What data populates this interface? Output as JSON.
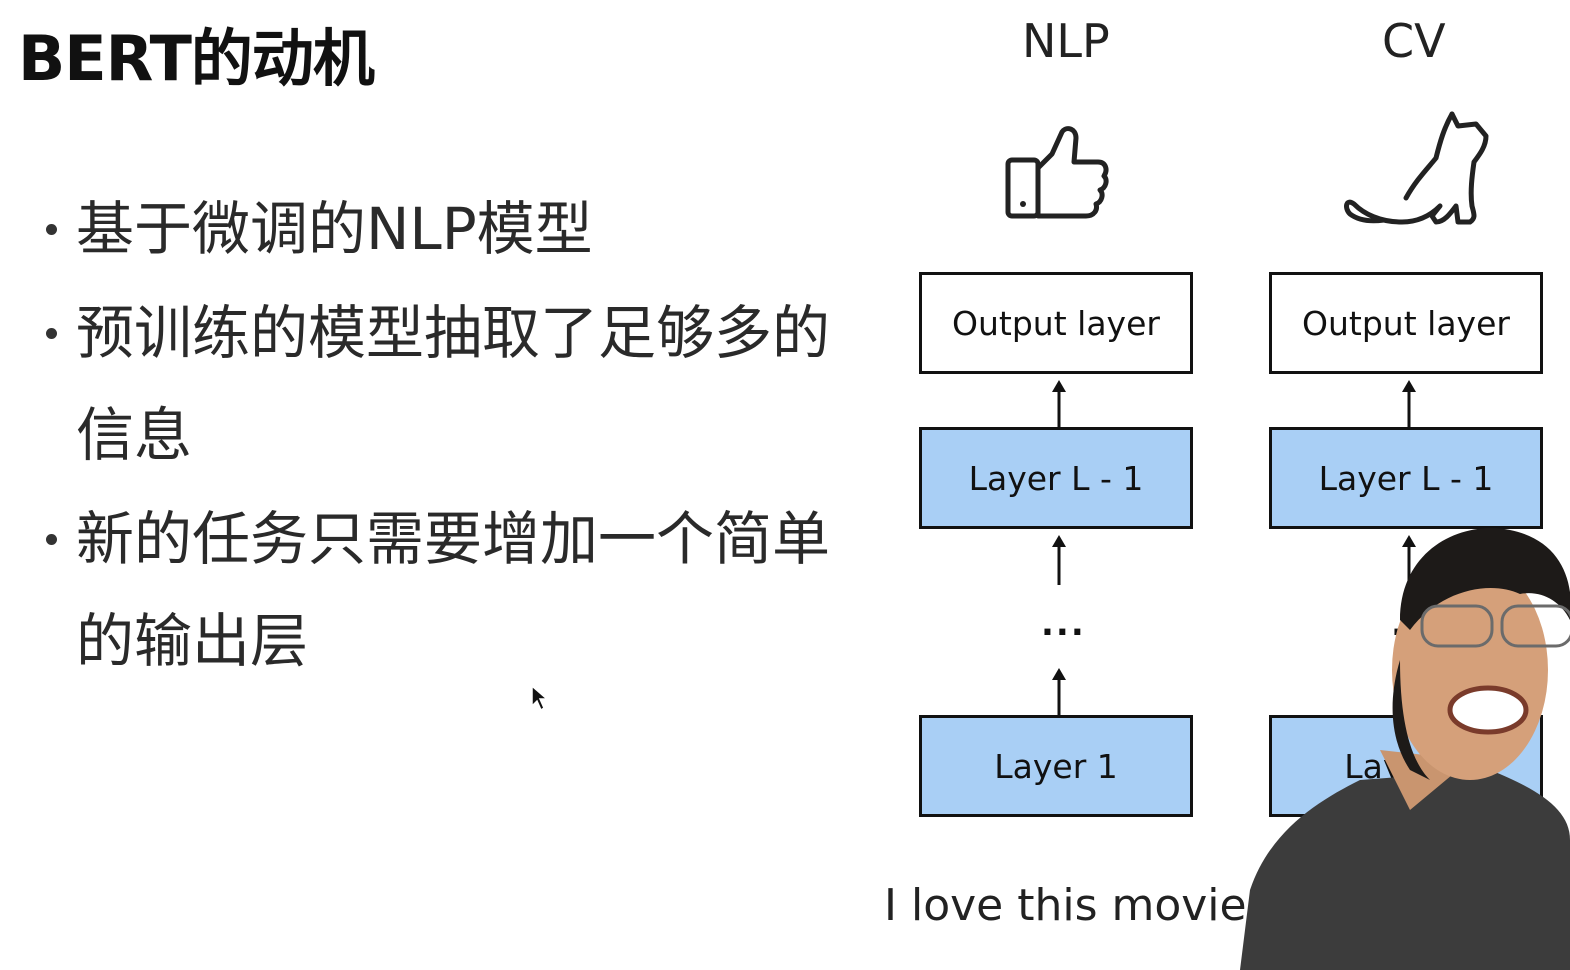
{
  "slide": {
    "title": "BERT的动机",
    "bullets": [
      {
        "text": "基于微调的NLP模型"
      },
      {
        "text": "预训练的模型抽取了足够多的信息"
      },
      {
        "text": "新的任务只需要增加一个简单的输出层"
      }
    ]
  },
  "diagram": {
    "columns": [
      {
        "heading": "NLP",
        "icon": "thumbs-up-icon",
        "output_label": "Output layer",
        "top_layer_label": "Layer L - 1",
        "ellipsis": "...",
        "bottom_layer_label": "Layer 1",
        "input_caption": "I love this movie"
      },
      {
        "heading": "CV",
        "icon": "cat-icon",
        "output_label": "Output layer",
        "top_layer_label": "Layer L - 1",
        "ellipsis": "...",
        "bottom_layer_label": "Layer 1"
      }
    ],
    "colors": {
      "hidden_layer_fill": "#a9cff5",
      "output_layer_fill": "#ffffff",
      "border": "#111111"
    }
  }
}
